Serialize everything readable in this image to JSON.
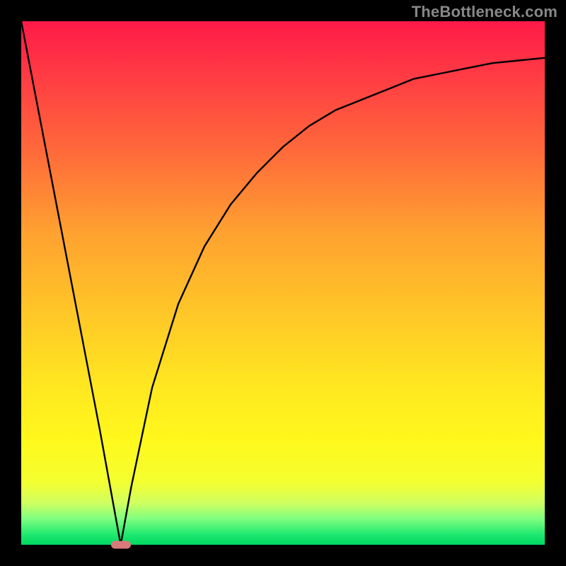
{
  "watermark": "TheBottleneck.com",
  "chart_data": {
    "type": "line",
    "title": "",
    "xlabel": "",
    "ylabel": "",
    "xlim": [
      0,
      100
    ],
    "ylim": [
      0,
      100
    ],
    "grid": false,
    "legend": false,
    "series": [
      {
        "name": "bottleneck-curve",
        "x": [
          0,
          5,
          10,
          15,
          17,
          19,
          21,
          25,
          30,
          35,
          40,
          45,
          50,
          55,
          60,
          65,
          70,
          75,
          80,
          85,
          90,
          95,
          100
        ],
        "y": [
          100,
          74,
          48,
          22,
          11,
          0,
          11,
          30,
          46,
          57,
          65,
          71,
          76,
          80,
          83,
          85,
          87,
          89,
          90,
          91,
          92,
          92.5,
          93
        ]
      }
    ],
    "marker": {
      "name": "optimal-point",
      "x": 19,
      "y": 0,
      "color": "#d97a7a"
    },
    "background_gradient": {
      "top_color": "#ff1a48",
      "bottom_color": "#00d860"
    }
  }
}
